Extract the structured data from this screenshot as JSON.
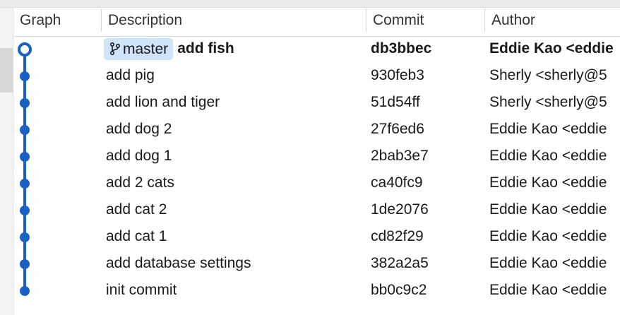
{
  "columns": {
    "graph": "Graph",
    "description": "Description",
    "commit": "Commit",
    "author": "Author"
  },
  "branch": {
    "name": "master",
    "icon": "branch-icon"
  },
  "colors": {
    "graph_line": "#1a61c4",
    "branch_tag_bg": "#cfe3fb"
  },
  "commits": [
    {
      "description": "add fish",
      "hash": "db3bbec",
      "author": "Eddie Kao <eddie",
      "is_head": true
    },
    {
      "description": "add pig",
      "hash": "930feb3",
      "author": "Sherly <sherly@5"
    },
    {
      "description": "add lion and tiger",
      "hash": "51d54ff",
      "author": "Sherly <sherly@5"
    },
    {
      "description": "add dog 2",
      "hash": "27f6ed6",
      "author": "Eddie Kao <eddie"
    },
    {
      "description": "add dog 1",
      "hash": "2bab3e7",
      "author": "Eddie Kao <eddie"
    },
    {
      "description": "add 2 cats",
      "hash": "ca40fc9",
      "author": "Eddie Kao <eddie"
    },
    {
      "description": "add cat 2",
      "hash": "1de2076",
      "author": "Eddie Kao <eddie"
    },
    {
      "description": "add cat 1",
      "hash": "cd82f29",
      "author": "Eddie Kao <eddie"
    },
    {
      "description": "add database settings",
      "hash": "382a2a5",
      "author": "Eddie Kao <eddie"
    },
    {
      "description": "init commit",
      "hash": "bb0c9c2",
      "author": "Eddie Kao <eddie"
    }
  ]
}
